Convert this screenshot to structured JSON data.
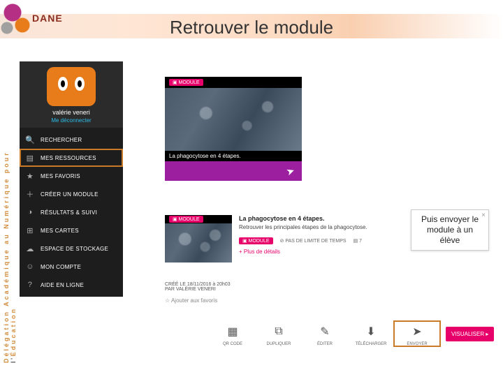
{
  "header": {
    "logo_text": "DANE",
    "title": "Retrouver le module"
  },
  "side_label": {
    "line1": "Délégation Académique au Numérique pour",
    "line2": "Éducation"
  },
  "sidebar": {
    "profile_name": "valérie veneri",
    "logout": "Me déconnecter",
    "items": [
      {
        "icon": "🔍",
        "label": "RECHERCHER"
      },
      {
        "icon": "▤",
        "label": "MES RESSOURCES"
      },
      {
        "icon": "★",
        "label": "MES FAVORIS"
      },
      {
        "icon": "＋",
        "label": "CRÉER UN MODULE"
      },
      {
        "icon": "◑",
        "label": "RÉSULTATS & SUIVI"
      },
      {
        "icon": "⊞",
        "label": "MES CARTES"
      },
      {
        "icon": "☁",
        "label": "ESPACE DE STOCKAGE"
      },
      {
        "icon": "☺",
        "label": "MON COMPTE"
      },
      {
        "icon": "?",
        "label": "AIDE EN LIGNE"
      }
    ]
  },
  "module_card": {
    "badge": "▣ MODULE",
    "title": "La phagocytose en 4 étapes."
  },
  "module_list": {
    "title": "La phagocytose en 4 étapes.",
    "desc": "Retrouver les principales étapes de la phagocytose.",
    "badge": "▣ MODULE",
    "limit": "⊘ PAS DE LIMITE DE TEMPS",
    "count": "▤ 7",
    "details": "+ Plus de détails",
    "created": "CRÉÉ LE 18/11/2016 à 20h03",
    "by": "PAR VALÉRIE VENERI",
    "fav": "☆  Ajouter aux favoris"
  },
  "actions": [
    {
      "icon": "▦",
      "label": "QR CODE"
    },
    {
      "icon": "⧉",
      "label": "DUPLIQUER"
    },
    {
      "icon": "✎",
      "label": "ÉDITER"
    },
    {
      "icon": "⬇",
      "label": "TÉLÉCHARGER"
    },
    {
      "icon": "➤",
      "label": "ENVOYER"
    }
  ],
  "visualiser": "VISUALISER ▸",
  "tooltip": {
    "line1": "Puis envoyer le",
    "line2": "module  à un",
    "line3": "élève"
  }
}
